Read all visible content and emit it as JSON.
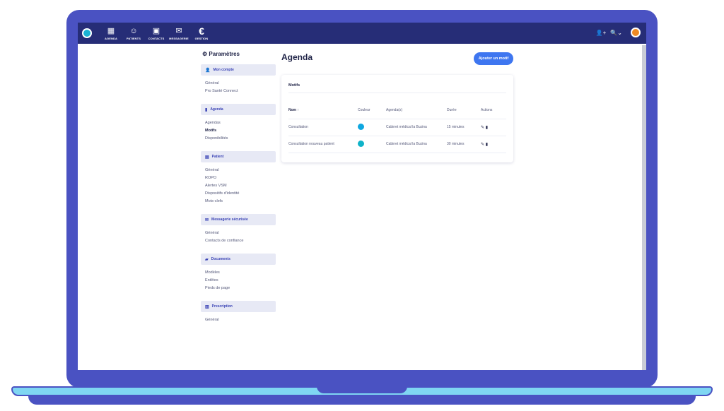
{
  "topbar": {
    "nav": [
      {
        "label": "AGENDA",
        "icon": "calendar-icon",
        "glyph": "▦"
      },
      {
        "label": "PATIENTS",
        "icon": "users-icon",
        "glyph": "☺"
      },
      {
        "label": "CONTACTS",
        "icon": "contacts-icon",
        "glyph": "▣"
      },
      {
        "label": "MESSAGERIE",
        "icon": "mail-icon",
        "glyph": "✉"
      },
      {
        "label": "GESTION",
        "icon": "euro-icon",
        "glyph": "€"
      }
    ],
    "right_icons": {
      "user": "👤+",
      "search": "🔍⌄"
    }
  },
  "settings": {
    "title": "Paramètres",
    "groups": [
      {
        "label": "Mon compte",
        "icon": "user-icon",
        "glyph": "👤",
        "items": [
          "Général",
          "Pro Santé Connect"
        ]
      },
      {
        "label": "Agenda",
        "icon": "agenda-icon",
        "glyph": "▮",
        "items": [
          "Agendas",
          "Motifs",
          "Disponibilités"
        ],
        "active": "Motifs"
      },
      {
        "label": "Patient",
        "icon": "patient-icon",
        "glyph": "▤",
        "items": [
          "Général",
          "ROPO",
          "Alertes VSM",
          "Dispositifs d'identité",
          "Mots-clefs"
        ]
      },
      {
        "label": "Messagerie sécurisée",
        "icon": "mail-icon",
        "glyph": "✉",
        "items": [
          "Général",
          "Contacts de confiance"
        ]
      },
      {
        "label": "Documents",
        "icon": "folder-icon",
        "glyph": "▰",
        "items": [
          "Modèles",
          "Entêtes",
          "Pieds de page"
        ]
      },
      {
        "label": "Prescription",
        "icon": "prescription-icon",
        "glyph": "▥",
        "items": [
          "Général"
        ]
      }
    ]
  },
  "main": {
    "title": "Agenda",
    "add_button": "Ajouter un motif",
    "card_title": "Motifs",
    "columns": [
      "Nom ↑",
      "Couleur",
      "Agenda(s)",
      "Durée",
      "Actions"
    ],
    "rows": [
      {
        "name": "Consultation",
        "color": "#0fa7e0",
        "agenda": "Cabinet médical la Buzina",
        "duration": "15 minutes",
        "actions": "✎ ▮"
      },
      {
        "name": "Consultation nouveau patient",
        "color": "#0fb3c9",
        "agenda": "Cabinet médical la Buzina",
        "duration": "30 minutes",
        "actions": "✎ ▮"
      }
    ]
  }
}
